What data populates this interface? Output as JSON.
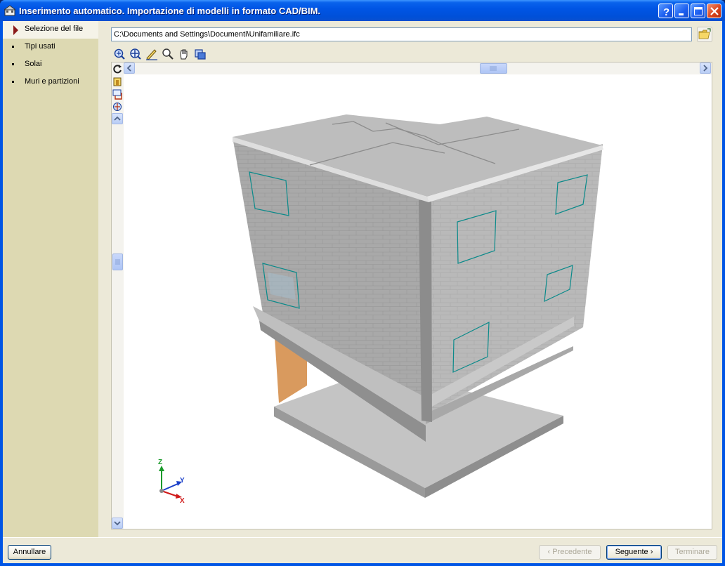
{
  "window": {
    "title": "Inserimento automatico. Importazione di modelli in formato CAD/BIM."
  },
  "sidebar": {
    "items": [
      {
        "label": "Selezione del file",
        "active": true
      },
      {
        "label": "Tipi usati",
        "active": false
      },
      {
        "label": "Solai",
        "active": false
      },
      {
        "label": "Muri e partizioni",
        "active": false
      }
    ]
  },
  "file": {
    "path": "C:\\Documents and Settings\\Documenti\\Unifamiliare.ifc"
  },
  "toolbar": {
    "icons": [
      "zoom-extents-icon",
      "zoom-window-icon",
      "pan-pen-icon",
      "zoom-icon",
      "hand-pan-icon",
      "view-icon"
    ]
  },
  "axes": {
    "z": "Z",
    "y": "Y",
    "x": "X"
  },
  "buttons": {
    "cancel": "Annullare",
    "previous": "‹ Precedente",
    "next": "Seguente ›",
    "finish": "Terminare"
  },
  "colors": {
    "title_bar": "#0055e5",
    "active_step_marker": "#8b1a1a",
    "window_outline": "#0a8a8a"
  }
}
